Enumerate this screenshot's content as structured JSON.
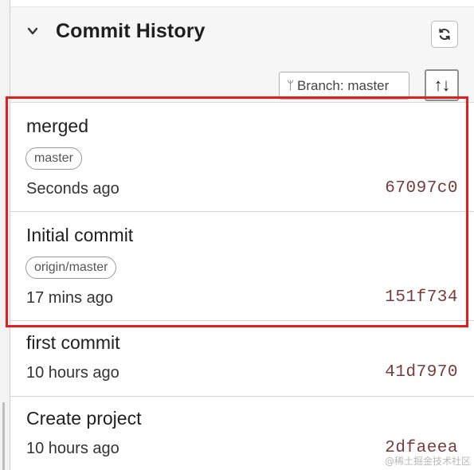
{
  "panel": {
    "title": "Commit History",
    "branch_label": "Branch: master",
    "sort_glyph": "↑↓",
    "refresh_icon": "refresh-icon",
    "collapse_icon": "chevron-down-icon"
  },
  "commits": [
    {
      "message": "merged",
      "ref": "master",
      "time": "Seconds ago",
      "hash": "67097c0"
    },
    {
      "message": "Initial commit",
      "ref": "origin/master",
      "time": "17 mins ago",
      "hash": "151f734"
    },
    {
      "message": "first commit",
      "time": "10 hours ago",
      "hash": "41d7970"
    },
    {
      "message": "Create project",
      "time": "10 hours ago",
      "hash": "2dfaeea"
    }
  ],
  "watermark": "@稀土掘金技术社区",
  "colors": {
    "highlight": "#e02020",
    "hash": "#7a3b3b",
    "header_bg": "#f6f6f6"
  }
}
